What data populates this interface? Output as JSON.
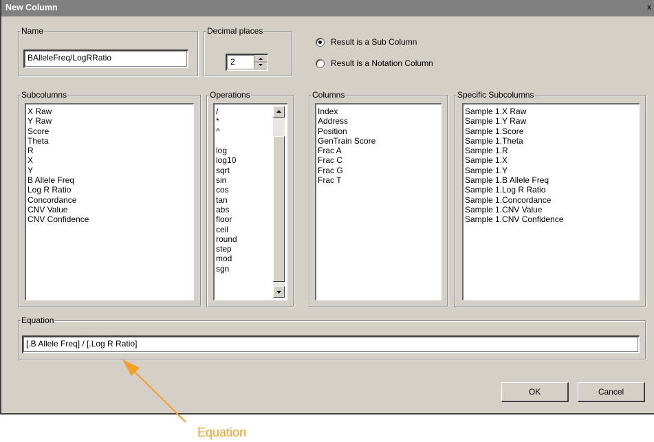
{
  "window": {
    "title": "New Column",
    "close_glyph": "x"
  },
  "name_group": {
    "label": "Name",
    "value": "BAlleleFreq/LogRRatio"
  },
  "decimal_group": {
    "label": "Decimal places",
    "value": "2"
  },
  "result_options": [
    {
      "label": "Result is a Sub Column",
      "selected": true
    },
    {
      "label": "Result is a Notation Column",
      "selected": false
    }
  ],
  "subcolumns": {
    "label": "Subcolumns",
    "items": [
      "X Raw",
      "Y Raw",
      "Score",
      "Theta",
      "R",
      "X",
      "Y",
      "B Allele Freq",
      "Log R Ratio",
      "Concordance",
      "CNV Value",
      "CNV Confidence"
    ]
  },
  "operations": {
    "label": "Operations",
    "items": [
      "/",
      "*",
      "^",
      "",
      "log",
      "log10",
      "sqrt",
      "sin",
      "cos",
      "tan",
      "abs",
      "floor",
      "ceil",
      "round",
      "step",
      "mod",
      "sgn"
    ]
  },
  "columns": {
    "label": "Columns",
    "items": [
      "Index",
      "Address",
      "Position",
      "GenTrain Score",
      "Frac A",
      "Frac C",
      "Frac G",
      "Frac T"
    ]
  },
  "specific_subcolumns": {
    "label": "Specific Subcolumns",
    "items": [
      "Sample 1.X Raw",
      "Sample 1.Y Raw",
      "Sample 1.Score",
      "Sample 1.Theta",
      "Sample 1.R",
      "Sample 1.X",
      "Sample 1.Y",
      "Sample 1.B Allele Freq",
      "Sample 1.Log R Ratio",
      "Sample 1.Concordance",
      "Sample 1.CNV Value",
      "Sample 1.CNV Confidence"
    ]
  },
  "equation_group": {
    "label": "Equation",
    "value": "[.B Allele Freq] / [.Log R Ratio]"
  },
  "buttons": {
    "ok": "OK",
    "cancel": "Cancel"
  },
  "annotation": {
    "text": "Equation",
    "color": "#f5a020"
  },
  "icons": {
    "spinner": "spin-arrows-icon",
    "scroll_up": "scroll-up-icon",
    "scroll_down": "scroll-down-icon"
  }
}
